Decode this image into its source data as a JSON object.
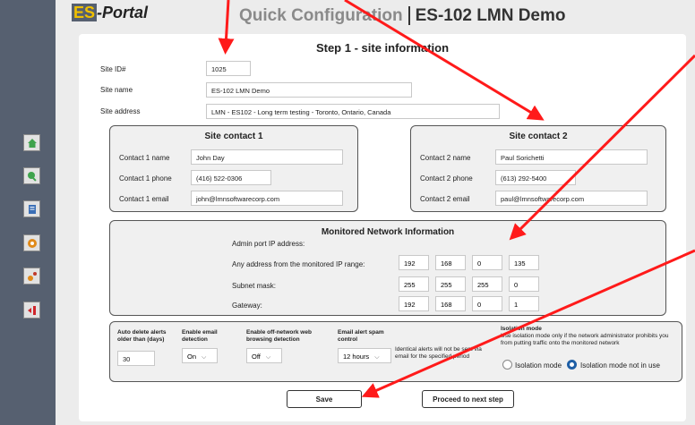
{
  "app": {
    "logo_es": "ES",
    "logo_portal": "-Portal",
    "page_title": "Quick Configuration",
    "site_title": "ES-102 LMN Demo"
  },
  "sidebar": {
    "items": [
      {
        "icon": "home-icon",
        "color": "#2e9a3c"
      },
      {
        "icon": "search-icon",
        "color": "#2e9a3c"
      },
      {
        "icon": "document-icon",
        "color": "#3b6fb6"
      },
      {
        "icon": "gear-icon",
        "color": "#e08a1a"
      },
      {
        "icon": "network-icon",
        "color": "#e08a1a"
      },
      {
        "icon": "logout-icon",
        "color": "#d0262b"
      }
    ]
  },
  "step": {
    "title": "Step 1 - site information"
  },
  "site": {
    "id_label": "Site ID#",
    "id_value": "1025",
    "name_label": "Site name",
    "name_value": "ES-102 LMN Demo",
    "address_label": "Site address",
    "address_value": "LMN - ES102 - Long term testing - Toronto, Ontario, Canada"
  },
  "contact1": {
    "title": "Site contact 1",
    "name_label": "Contact 1 name",
    "name_value": "John Day",
    "phone_label": "Contact 1 phone",
    "phone_value": "(416) 522-0306",
    "email_label": "Contact 1 email",
    "email_value": "john@lmnsoftwarecorp.com"
  },
  "contact2": {
    "title": "Site contact 2",
    "name_label": "Contact 2 name",
    "name_value": "Paul Sorichetti",
    "phone_label": "Contact 2 phone",
    "phone_value": "(613) 292-5400",
    "email_label": "Contact 2 email",
    "email_value": "paul@lmnsoftwarecorp.com"
  },
  "network": {
    "title": "Monitored Network Information",
    "admin_label": "Admin port IP address:",
    "any_label": "Any address from the monitored IP range:",
    "any_ip": [
      "192",
      "168",
      "0",
      "135"
    ],
    "mask_label": "Subnet mask:",
    "mask_ip": [
      "255",
      "255",
      "255",
      "0"
    ],
    "gw_label": "Gateway:",
    "gw_ip": [
      "192",
      "168",
      "0",
      "1"
    ]
  },
  "settings": {
    "auto_delete_label": "Auto delete alerts older than (days)",
    "auto_delete_value": "30",
    "email_label": "Enable email detection",
    "email_value": "On",
    "offnet_label": "Enable off-network web browsing detection",
    "offnet_value": "Off",
    "spam_label": "Email alert spam control",
    "spam_value": "12 hours",
    "spam_note": "Identical alerts will not be sent via email for the specified period",
    "isolation_title": "Isolation mode",
    "isolation_note": "Use isolation mode only if the network administrator prohibits you from putting traffic onto the monitored network",
    "isolation_on_label": "Isolation mode",
    "isolation_off_label": "Isolation mode not in use"
  },
  "buttons": {
    "save": "Save",
    "next": "Proceed to next step"
  },
  "annotation_color": "#ff1a1a"
}
